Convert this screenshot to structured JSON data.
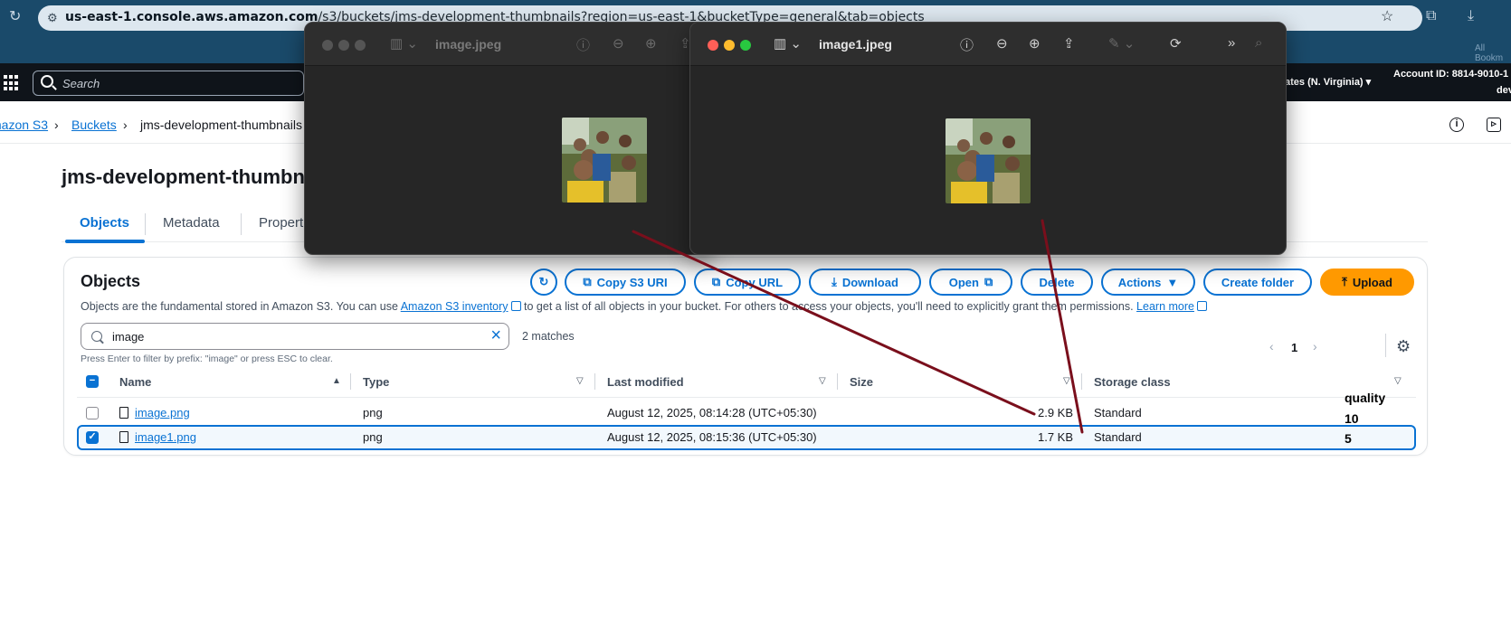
{
  "browser": {
    "url_host": "us-east-1.console.aws.amazon.com",
    "url_path": "/s3/buckets/jms-development-thumbnails?region=us-east-1&bucketType=general&tab=objects",
    "ext_label": "All Bookm"
  },
  "awsnav": {
    "search_placeholder": "Search",
    "region": "ates (N. Virginia)",
    "account": "Account ID: 8814-9010-1",
    "account_line2": "dev"
  },
  "breadcrumb": {
    "items": [
      "mazon S3",
      "Buckets",
      "jms-development-thumbnails"
    ]
  },
  "page": {
    "title": "jms-development-thumbn",
    "tabs": [
      "Objects",
      "Metadata",
      "Propert"
    ]
  },
  "objects": {
    "title": "Objects",
    "desc_1": "Objects are the fundamental stored in Amazon S3. You can use",
    "desc_link": "Amazon S3 inventory",
    "desc_2": "to get a list of all objects in your bucket. For others to access your objects, you'll need to explicitly grant them permissions.",
    "learn_more": "Learn more",
    "buttons": {
      "copy_s3_uri": "Copy S3 URI",
      "copy_url": "Copy URL",
      "download": "Download",
      "open": "Open",
      "delete": "Delete",
      "actions": "Actions",
      "create_folder": "Create folder",
      "upload": "Upload"
    },
    "filter_value": "image",
    "matches": "2 matches",
    "hint": "Press Enter to filter by prefix: \"image\" or press ESC to clear.",
    "page_number": "1",
    "columns": [
      "Name",
      "Type",
      "Last modified",
      "Size",
      "Storage class"
    ],
    "rows": [
      {
        "name": "image.png",
        "type": "png",
        "modified": "August 12, 2025, 08:14:28 (UTC+05:30)",
        "size": "2.9 KB",
        "storage": "Standard",
        "selected": false
      },
      {
        "name": "image1.png",
        "type": "png",
        "modified": "August 12, 2025, 08:15:36 (UTC+05:30)",
        "size": "1.7 KB",
        "storage": "Standard",
        "selected": true
      }
    ]
  },
  "annotation": {
    "label": "quality",
    "value_1": "10",
    "value_2": "5",
    "color": "#7a0f1c"
  },
  "previews": [
    {
      "title": "image.jpeg",
      "active": false
    },
    {
      "title": "image1.jpeg",
      "active": true
    }
  ],
  "colors": {
    "accent": "#0972d3",
    "upload": "#ff9900",
    "nav": "#0f141a"
  }
}
